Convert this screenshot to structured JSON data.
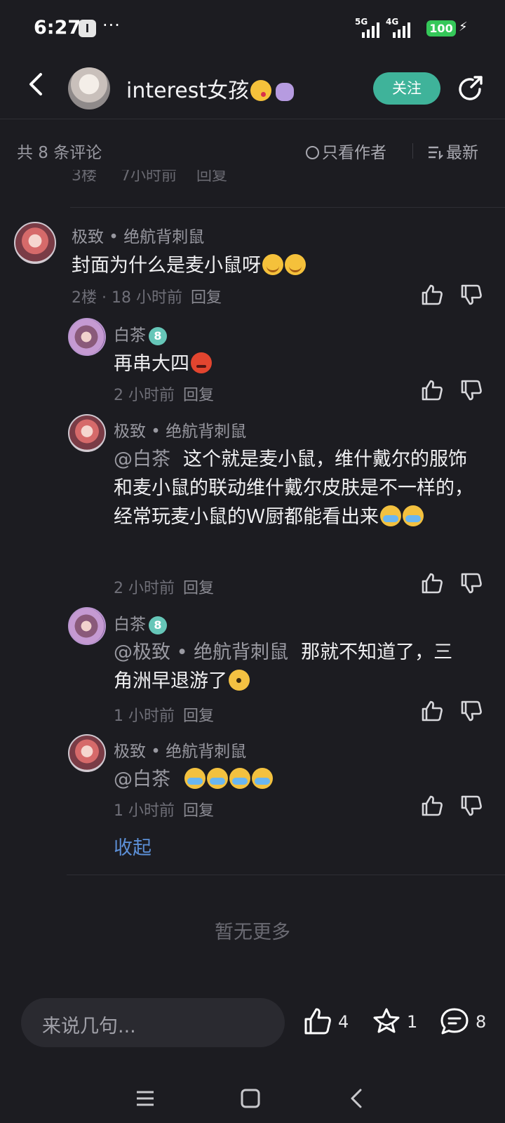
{
  "status_bar": {
    "time": "6:27",
    "app_icon_text": "l",
    "dots": "···",
    "network_1": "5G",
    "network_2": "4G",
    "battery": "100"
  },
  "header": {
    "author_name": "interest女孩",
    "follow_label": "关注"
  },
  "comment_bar": {
    "count_text": "共 8 条评论",
    "author_only_label": "只看作者",
    "sort_label": "最新"
  },
  "prev_remnant": {
    "floor": "3楼",
    "time": "7小时前",
    "reply": "回复"
  },
  "comments": [
    {
      "name": "极致 • 绝航背刺鼠",
      "text": "封面为什么是麦小鼠呀",
      "meta": "2楼 · 18 小时前",
      "reply": "回复"
    },
    {
      "name": "白茶",
      "level": "8",
      "text": "再串大四",
      "meta": "2 小时前",
      "reply": "回复"
    },
    {
      "name": "极致 • 绝航背刺鼠",
      "mention": "@白茶",
      "text": "这个就是麦小鼠，维什戴尔的服饰和麦小鼠的联动维什戴尔皮肤是不一样的，经常玩麦小鼠的Ｗ厨都能看出来",
      "meta": "2 小时前",
      "reply": "回复"
    },
    {
      "name": "白茶",
      "level": "8",
      "mention": "@极致 • 绝航背刺鼠",
      "text": "那就不知道了，三角洲早退游了",
      "meta": "1 小时前",
      "reply": "回复"
    },
    {
      "name": "极致 • 绝航背刺鼠",
      "mention": "@白茶",
      "text": "",
      "meta": "1 小时前",
      "reply": "回复"
    }
  ],
  "collapse_label": "收起",
  "no_more_text": "暂无更多",
  "bottom_bar": {
    "input_placeholder": "来说几句...",
    "like_count": "4",
    "favorite_count": "1",
    "comment_count": "8"
  },
  "colors": {
    "background": "#1c1c21",
    "follow_button": "#3fb39a",
    "link": "#5c8fd6"
  }
}
